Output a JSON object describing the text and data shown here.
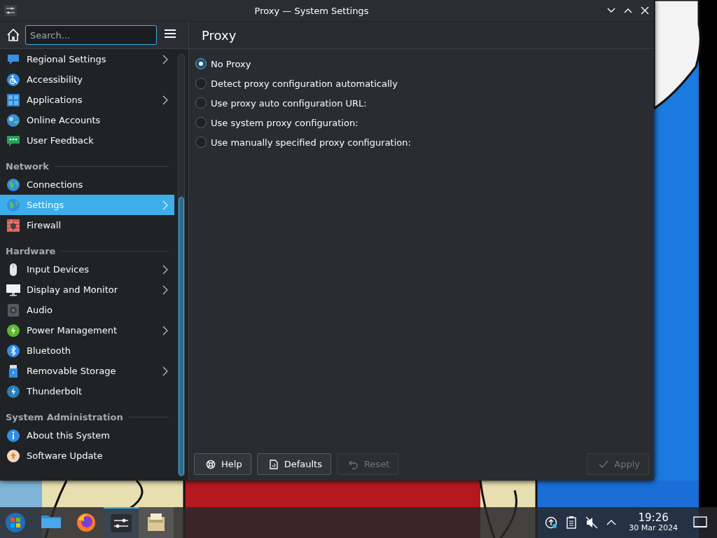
{
  "window": {
    "title": "Proxy — System Settings"
  },
  "sidebar": {
    "search": {
      "placeholder": "Search..."
    },
    "sections": [
      {
        "items": [
          {
            "label": "Regional Settings",
            "expandable": true,
            "selected": false
          },
          {
            "label": "Accessibility",
            "expandable": false,
            "selected": false
          },
          {
            "label": "Applications",
            "expandable": true,
            "selected": false
          },
          {
            "label": "Online Accounts",
            "expandable": false,
            "selected": false
          },
          {
            "label": "User Feedback",
            "expandable": false,
            "selected": false
          }
        ]
      },
      {
        "heading": "Network",
        "items": [
          {
            "label": "Connections",
            "expandable": false,
            "selected": false
          },
          {
            "label": "Settings",
            "expandable": true,
            "selected": true
          },
          {
            "label": "Firewall",
            "expandable": false,
            "selected": false
          }
        ]
      },
      {
        "heading": "Hardware",
        "items": [
          {
            "label": "Input Devices",
            "expandable": true,
            "selected": false
          },
          {
            "label": "Display and Monitor",
            "expandable": true,
            "selected": false
          },
          {
            "label": "Audio",
            "expandable": false,
            "selected": false
          },
          {
            "label": "Power Management",
            "expandable": true,
            "selected": false
          },
          {
            "label": "Bluetooth",
            "expandable": false,
            "selected": false
          },
          {
            "label": "Removable Storage",
            "expandable": true,
            "selected": false
          },
          {
            "label": "Thunderbolt",
            "expandable": false,
            "selected": false
          }
        ]
      },
      {
        "heading": "System Administration",
        "items": [
          {
            "label": "About this System",
            "expandable": false,
            "selected": false
          },
          {
            "label": "Software Update",
            "expandable": false,
            "selected": false
          }
        ]
      }
    ]
  },
  "page": {
    "title": "Proxy",
    "options": [
      {
        "label": "No Proxy",
        "selected": true
      },
      {
        "label": "Detect proxy configuration automatically",
        "selected": false
      },
      {
        "label": "Use proxy auto configuration URL:",
        "selected": false
      },
      {
        "label": "Use system proxy configuration:",
        "selected": false
      },
      {
        "label": "Use manually specified proxy configuration:",
        "selected": false
      }
    ]
  },
  "buttons": [
    {
      "label": "Help",
      "disabled": false
    },
    {
      "label": "Defaults",
      "disabled": false
    },
    {
      "label": "Reset",
      "disabled": true
    },
    {
      "label": "Apply",
      "disabled": true
    }
  ],
  "taskbar": {
    "tasks": [
      {
        "selected": false
      },
      {
        "selected": false
      },
      {
        "selected": true
      },
      {
        "selected": false
      }
    ],
    "clock": {
      "time": "19:26",
      "date": "30 Mar 2024"
    }
  }
}
